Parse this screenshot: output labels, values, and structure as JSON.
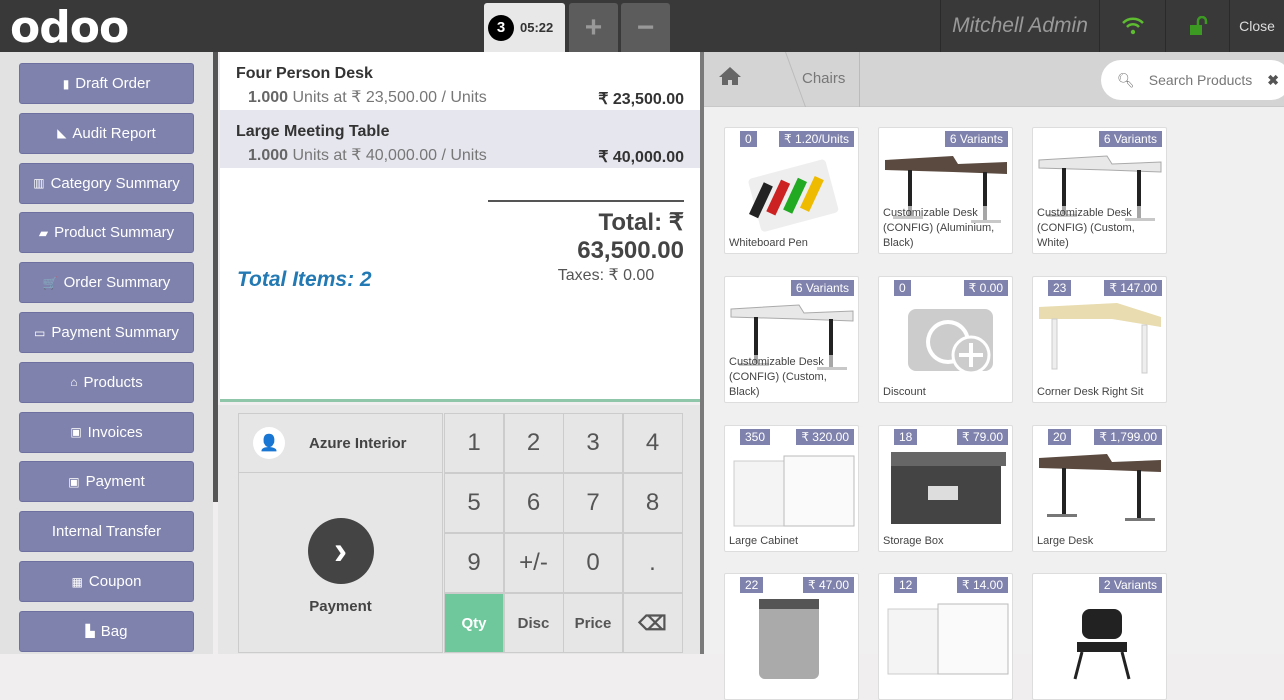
{
  "header": {
    "logo": "odoo",
    "order_count": "3",
    "order_time": "05:22",
    "add": "+",
    "remove": "−",
    "user": "Mitchell Admin",
    "close": "Close"
  },
  "sidebar": [
    {
      "label": "Draft Order",
      "icon": "file-icon",
      "glyph": "▮"
    },
    {
      "label": "Audit Report",
      "icon": "area-chart-icon",
      "glyph": "◣"
    },
    {
      "label": "Category Summary",
      "icon": "bar-chart-icon",
      "glyph": "▥"
    },
    {
      "label": "Product Summary",
      "icon": "sticky-note-icon",
      "glyph": "▰"
    },
    {
      "label": "Order Summary",
      "icon": "cart-icon",
      "glyph": "🛒"
    },
    {
      "label": "Payment Summary",
      "icon": "credit-card-icon",
      "glyph": "▭"
    },
    {
      "label": "Products",
      "icon": "bank-icon",
      "glyph": "⌂"
    },
    {
      "label": "Invoices",
      "icon": "money-icon",
      "glyph": "▣"
    },
    {
      "label": "Payment",
      "icon": "money-icon",
      "glyph": "▣"
    },
    {
      "label": "Internal Transfer",
      "icon": "",
      "glyph": ""
    },
    {
      "label": "Coupon",
      "icon": "gift-icon",
      "glyph": "▦"
    },
    {
      "label": "Bag",
      "icon": "shopping-bag-icon",
      "glyph": "▙"
    }
  ],
  "order": {
    "lines": [
      {
        "name": "Four Person Desk",
        "qty": "1.000",
        "desc": "Units at ₹ 23,500.00 / Units",
        "price": "₹ 23,500.00",
        "selected": false
      },
      {
        "name": "Large Meeting Table",
        "qty": "1.000",
        "desc": "Units at ₹ 40,000.00 / Units",
        "price": "₹ 40,000.00",
        "selected": true
      }
    ],
    "total": "Total: ₹ 63,500.00",
    "taxes": "Taxes: ₹ 0.00",
    "total_items": "Total Items: 2"
  },
  "pad": {
    "customer": "Azure Interior",
    "payment": "Payment",
    "keys": [
      "1",
      "2",
      "3",
      "4",
      "5",
      "6",
      "7",
      "8",
      "9",
      "+/-",
      "0",
      ".",
      "Qty",
      "Disc",
      "Price",
      "⌫"
    ],
    "active": "Qty"
  },
  "breadcrumb": {
    "category": "Chairs"
  },
  "search": {
    "placeholder": "Search Products"
  },
  "products": [
    {
      "name": "Whiteboard Pen",
      "left": "0",
      "right": "₹ 1.20/Units",
      "kind": "pens"
    },
    {
      "name": "Customizable Desk (CONFIG) (Aluminium, Black)",
      "left": "",
      "right": "6 Variants",
      "kind": "desk-dark"
    },
    {
      "name": "Customizable Desk (CONFIG) (Custom, White)",
      "left": "",
      "right": "6 Variants",
      "kind": "desk-white"
    },
    {
      "name": "Customizable Desk (CONFIG) (Custom, Black)",
      "left": "",
      "right": "6 Variants",
      "kind": "desk-white"
    },
    {
      "name": "Discount",
      "left": "0",
      "right": "₹ 0.00",
      "kind": "camera"
    },
    {
      "name": "Corner Desk Right Sit",
      "left": "23",
      "right": "₹ 147.00",
      "kind": "desk-beige"
    },
    {
      "name": "Large Cabinet",
      "left": "350",
      "right": "₹ 320.00",
      "kind": "cabinet"
    },
    {
      "name": "Storage Box",
      "left": "18",
      "right": "₹ 79.00",
      "kind": "box"
    },
    {
      "name": "Large Desk",
      "left": "20",
      "right": "₹ 1,799.00",
      "kind": "desk-dark"
    },
    {
      "name": "",
      "left": "22",
      "right": "₹ 47.00",
      "kind": "bin"
    },
    {
      "name": "",
      "left": "12",
      "right": "₹ 14.00",
      "kind": "cabinet"
    },
    {
      "name": "",
      "left": "",
      "right": "2 Variants",
      "kind": "chair"
    }
  ]
}
